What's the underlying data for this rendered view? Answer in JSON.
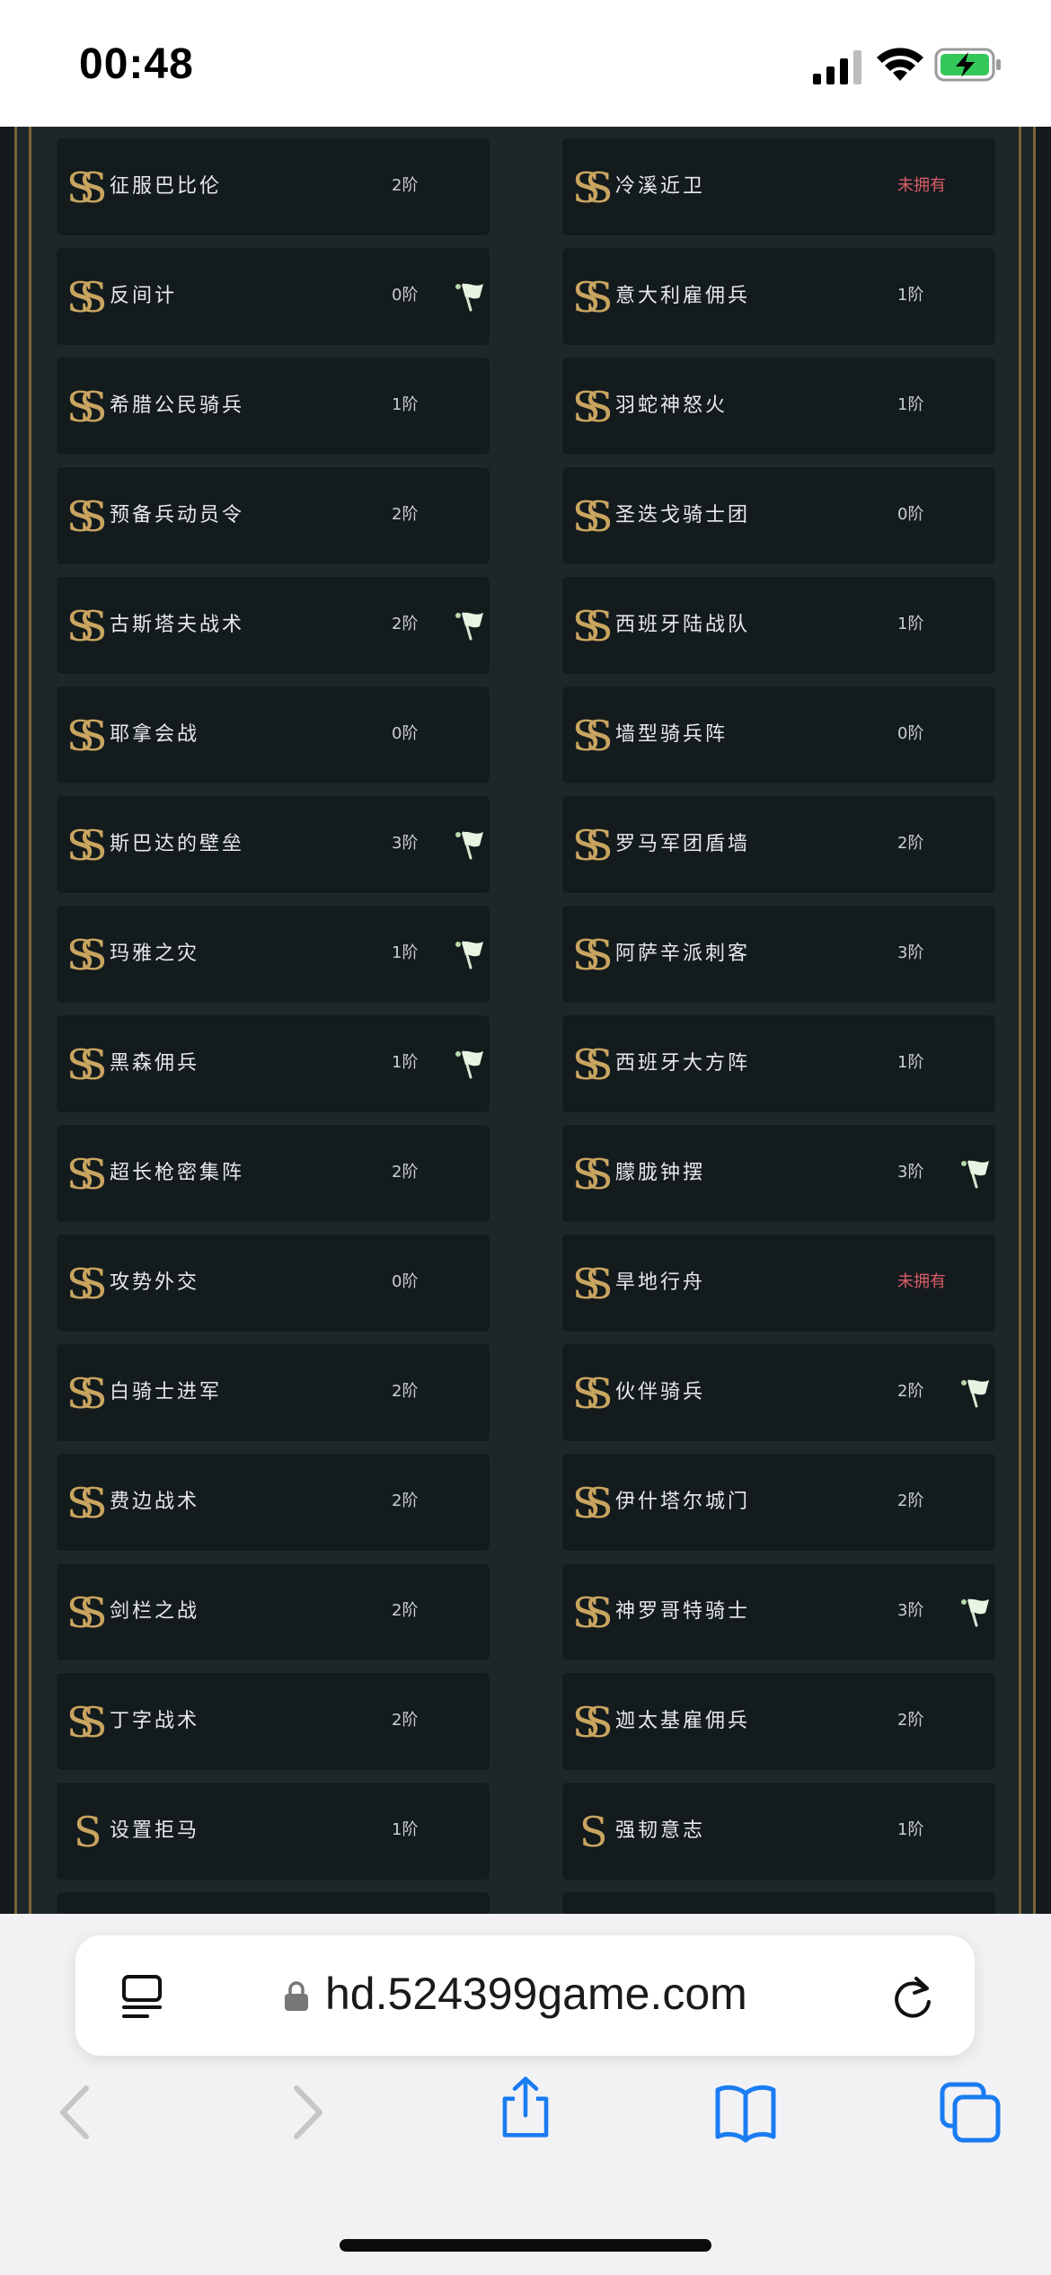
{
  "status_bar": {
    "time": "00:48"
  },
  "browser": {
    "url": "hd.524399game.com"
  },
  "colors": {
    "accent_gold": "#c9a560",
    "unowned_red": "#d85d6a",
    "card_bg": "#141b1d",
    "page_bg": "#1d2629"
  },
  "cards": [
    {
      "name": "征服巴比伦",
      "level": "2阶",
      "flag": false,
      "icon": "ss-rank-icon"
    },
    {
      "name": "冷溪近卫",
      "level": "未拥有",
      "unowned": true,
      "flag": false,
      "icon": "ss-rank-icon"
    },
    {
      "name": "反间计",
      "level": "0阶",
      "flag": true,
      "icon": "ss-rank-icon"
    },
    {
      "name": "意大利雇佣兵",
      "level": "1阶",
      "flag": false,
      "icon": "ss-rank-icon"
    },
    {
      "name": "希腊公民骑兵",
      "level": "1阶",
      "flag": false,
      "icon": "ss-rank-icon"
    },
    {
      "name": "羽蛇神怒火",
      "level": "1阶",
      "flag": false,
      "icon": "ss-rank-icon"
    },
    {
      "name": "预备兵动员令",
      "level": "2阶",
      "flag": false,
      "icon": "ss-rank-icon"
    },
    {
      "name": "圣迭戈骑士团",
      "level": "0阶",
      "flag": false,
      "icon": "ss-rank-icon"
    },
    {
      "name": "古斯塔夫战术",
      "level": "2阶",
      "flag": true,
      "icon": "ss-rank-icon"
    },
    {
      "name": "西班牙陆战队",
      "level": "1阶",
      "flag": false,
      "icon": "ss-rank-icon"
    },
    {
      "name": "耶拿会战",
      "level": "0阶",
      "flag": false,
      "icon": "ss-rank-icon"
    },
    {
      "name": "墙型骑兵阵",
      "level": "0阶",
      "flag": false,
      "icon": "ss-rank-icon"
    },
    {
      "name": "斯巴达的壁垒",
      "level": "3阶",
      "flag": true,
      "icon": "ss-rank-icon"
    },
    {
      "name": "罗马军团盾墙",
      "level": "2阶",
      "flag": false,
      "icon": "ss-rank-icon"
    },
    {
      "name": "玛雅之灾",
      "level": "1阶",
      "flag": true,
      "icon": "ss-rank-icon"
    },
    {
      "name": "阿萨辛派刺客",
      "level": "3阶",
      "flag": false,
      "icon": "ss-rank-icon"
    },
    {
      "name": "黑森佣兵",
      "level": "1阶",
      "flag": true,
      "icon": "ss-rank-icon"
    },
    {
      "name": "西班牙大方阵",
      "level": "1阶",
      "flag": false,
      "icon": "ss-rank-icon"
    },
    {
      "name": "超长枪密集阵",
      "level": "2阶",
      "flag": false,
      "icon": "ss-rank-icon"
    },
    {
      "name": "朦胧钟摆",
      "level": "3阶",
      "flag": true,
      "icon": "ss-rank-icon"
    },
    {
      "name": "攻势外交",
      "level": "0阶",
      "flag": false,
      "icon": "ss-rank-icon"
    },
    {
      "name": "旱地行舟",
      "level": "未拥有",
      "unowned": true,
      "flag": false,
      "icon": "ss-rank-icon"
    },
    {
      "name": "白骑士进军",
      "level": "2阶",
      "flag": false,
      "icon": "ss-rank-icon"
    },
    {
      "name": "伙伴骑兵",
      "level": "2阶",
      "flag": true,
      "icon": "ss-rank-icon"
    },
    {
      "name": "费边战术",
      "level": "2阶",
      "flag": false,
      "icon": "ss-rank-icon"
    },
    {
      "name": "伊什塔尔城门",
      "level": "2阶",
      "flag": false,
      "icon": "ss-rank-icon"
    },
    {
      "name": "剑栏之战",
      "level": "2阶",
      "flag": false,
      "icon": "ss-rank-icon"
    },
    {
      "name": "神罗哥特骑士",
      "level": "3阶",
      "flag": true,
      "icon": "ss-rank-icon"
    },
    {
      "name": "丁字战术",
      "level": "2阶",
      "flag": false,
      "icon": "ss-rank-icon"
    },
    {
      "name": "迦太基雇佣兵",
      "level": "2阶",
      "flag": false,
      "icon": "ss-rank-icon"
    },
    {
      "name": "设置拒马",
      "level": "1阶",
      "flag": false,
      "icon": "s-rank-icon"
    },
    {
      "name": "强韧意志",
      "level": "1阶",
      "flag": false,
      "icon": "s-rank-icon"
    },
    {
      "name": "",
      "level": "",
      "flag": false,
      "icon": ""
    },
    {
      "name": "",
      "level": "",
      "flag": false,
      "icon": ""
    }
  ]
}
